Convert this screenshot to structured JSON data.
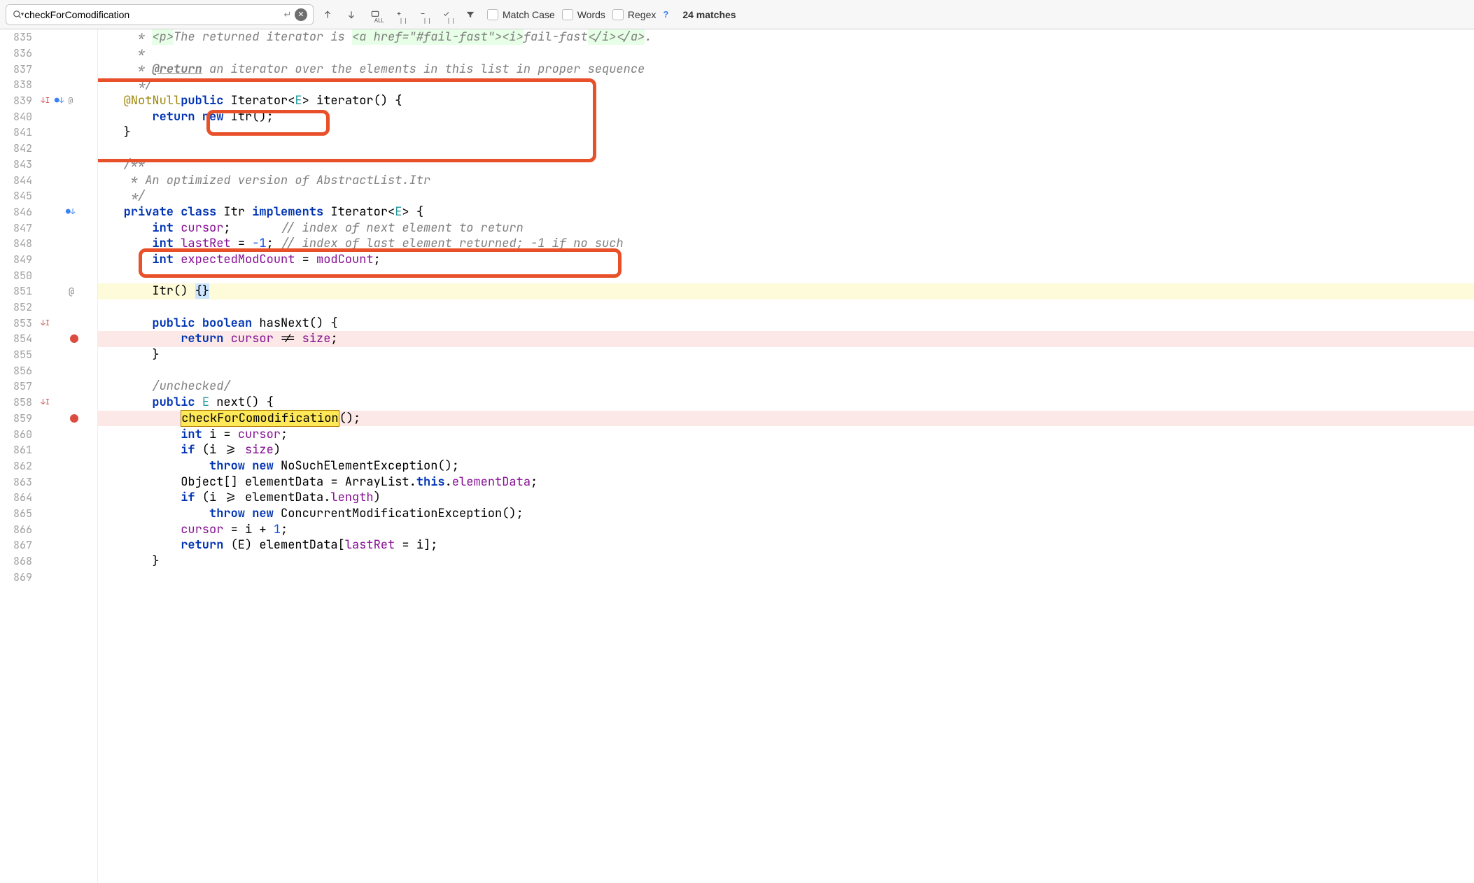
{
  "search": {
    "query": "checkForComodification",
    "matchcase_label": "Match Case",
    "words_label": "Words",
    "regex_label": "Regex",
    "matches": "24 matches"
  },
  "lines": {
    "start": 835,
    "count": 35
  },
  "code": {
    "l835": " * <p>The returned iterator is <a href=\"#fail-fast\"><i>fail-fast</i></a>.",
    "l836": " *",
    "l837_pre": " * ",
    "l837_tag": "@return",
    "l837_post": " an iterator over the elements in this list in proper sequence",
    "l838": " */",
    "l839_ann": "@NotNull",
    "l839_kw1": "public",
    "l839_type": " Iterator<",
    "l839_gen": "E",
    "l839_post": "> iterator() {",
    "l840_ret": "return ",
    "l840_new": "new",
    "l840_call": " Itr();",
    "l841": "}",
    "l843": "/**",
    "l844": " * An optimized version of AbstractList.Itr",
    "l845": " */",
    "l846_private": "private ",
    "l846_class": "class",
    "l846_name": " Itr ",
    "l846_impl": "implements",
    "l846_iter": " Iterator<",
    "l846_gen": "E",
    "l846_end": "> {",
    "l847_int": "int",
    "l847_name": " cursor",
    "l847_semi": ";       ",
    "l847_cmt": "// index of next element to return",
    "l848_int": "int",
    "l848_name": " lastRet",
    "l848_eq": " = ",
    "l848_val": "-1",
    "l848_semi": "; ",
    "l848_cmt": "// index of last element returned; -1 if no such",
    "l849_int": "int",
    "l849_name": " expectedModCount",
    "l849_eq": " = ",
    "l849_val": "modCount",
    "l849_semi": ";",
    "l851_name": "Itr() ",
    "l851_braces": "{}",
    "l853_pub": "public ",
    "l853_bool": "boolean",
    "l853_name": " hasNext() {",
    "l854_ret": "return",
    "l854_cur": " cursor",
    "l854_ne": " != ",
    "l854_size": "size",
    "l854_semi": ";",
    "l855": "}",
    "l857": "/unchecked/",
    "l858_pub": "public ",
    "l858_e": "E",
    "l858_name": " next() {",
    "l859_call": "checkForComodification",
    "l859_post": "();",
    "l860_int": "int",
    "l860_rest": " i = ",
    "l860_cur": "cursor",
    "l860_semi": ";",
    "l861_if": "if",
    "l861_cond": " (i >= ",
    "l861_size": "size",
    "l861_close": ")",
    "l862_throw": "throw ",
    "l862_new": "new",
    "l862_exc": " NoSuchElementException();",
    "l863_pre": "Object[] elementData = ArrayList.",
    "l863_this": "this",
    "l863_post": ".",
    "l863_ed": "elementData",
    "l863_semi": ";",
    "l864_if": "if",
    "l864_cond": " (i >= elementData.",
    "l864_len": "length",
    "l864_close": ")",
    "l865_throw": "throw ",
    "l865_new": "new",
    "l865_exc": " ConcurrentModificationException();",
    "l866_cur": "cursor",
    "l866_rest": " = i + ",
    "l866_one": "1",
    "l866_semi": ";",
    "l867_ret": "return",
    "l867_cast": " (E) elementData[",
    "l867_lr": "lastRet",
    "l867_rest": " = i];",
    "l868": "}"
  }
}
